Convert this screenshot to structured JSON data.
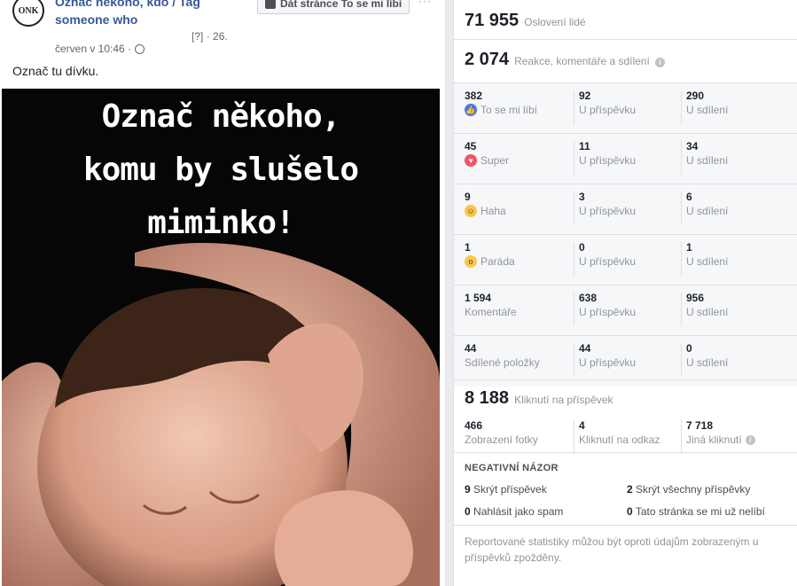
{
  "post": {
    "page_name": "Označ někoho, kdo / Tag someone who",
    "avatar_text": "ONK",
    "like_page_label": "Dát stránce To se mi líbí",
    "more_label": "···",
    "hint_label": "[?]",
    "date_number": "26.",
    "time": "červen v 10:46 ·",
    "text": "Označ tu dívku.",
    "image_text": [
      "Označ někoho,",
      "komu by slušelo",
      "miminko!"
    ]
  },
  "reach": {
    "value": "71 955",
    "label": "Oslovení lidé"
  },
  "engagement": {
    "value": "2 074",
    "label": "Reakce, komentáře a sdílení"
  },
  "reactions": [
    {
      "total": "382",
      "label": "To se mi líbí",
      "icon": "like-icon",
      "on_post": "92",
      "on_post_label": "U příspěvku",
      "shares": "290",
      "shares_label": "U sdílení"
    },
    {
      "total": "45",
      "label": "Super",
      "icon": "love-icon",
      "on_post": "11",
      "on_post_label": "U příspěvku",
      "shares": "34",
      "shares_label": "U sdílení"
    },
    {
      "total": "9",
      "label": "Haha",
      "icon": "haha-icon",
      "on_post": "3",
      "on_post_label": "U příspěvku",
      "shares": "6",
      "shares_label": "U sdílení"
    },
    {
      "total": "1",
      "label": "Paráda",
      "icon": "wow-icon",
      "on_post": "0",
      "on_post_label": "U příspěvku",
      "shares": "1",
      "shares_label": "U sdílení"
    },
    {
      "total": "1 594",
      "label": "Komentáře",
      "icon": "",
      "on_post": "638",
      "on_post_label": "U příspěvku",
      "shares": "956",
      "shares_label": "U sdílení"
    },
    {
      "total": "44",
      "label": "Sdílené položky",
      "icon": "",
      "on_post": "44",
      "on_post_label": "U příspěvku",
      "shares": "0",
      "shares_label": "U sdílení"
    }
  ],
  "clicks": {
    "value": "8 188",
    "label": "Kliknutí na příspěvek",
    "photo_views": "466",
    "photo_views_label": "Zobrazení fotky",
    "link_clicks": "4",
    "link_clicks_label": "Kliknutí na odkaz",
    "other_clicks": "7 718",
    "other_clicks_label": "Jiná kliknutí"
  },
  "negative": {
    "heading": "NEGATIVNÍ NÁZOR",
    "hide_post": "9",
    "hide_post_label": "Skrýt příspěvek",
    "hide_all": "2",
    "hide_all_label": "Skrýt všechny příspěvky",
    "spam": "0",
    "spam_label": "Nahlásit jako spam",
    "unlike": "0",
    "unlike_label": "Tato stránka se mi už nelíbí"
  },
  "note": "Reportované statistiky můžou být oproti údajům zobrazeným u příspěvků zpožděny.",
  "colors": {
    "link": "#385898",
    "like": "#4a74e5",
    "love": "#f25268",
    "haha": "#f7c84a"
  }
}
